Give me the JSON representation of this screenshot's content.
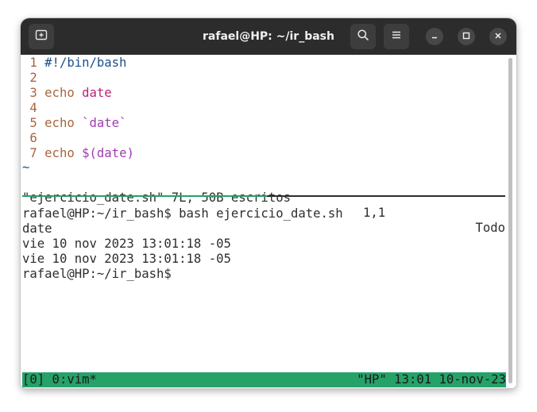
{
  "window": {
    "title": "rafael@HP: ~/ir_bash",
    "icons": {
      "new_tab": "new-tab-icon",
      "search": "search-icon",
      "menu": "hamburger-menu-icon",
      "minimize": "minimize-icon",
      "maximize": "maximize-icon",
      "close": "close-icon"
    }
  },
  "vim": {
    "lines": [
      {
        "num": "1",
        "parts": [
          {
            "text": "#!/bin/bash",
            "style": "shebang"
          }
        ]
      },
      {
        "num": "2",
        "parts": []
      },
      {
        "num": "3",
        "parts": [
          {
            "text": "echo ",
            "style": "kw"
          },
          {
            "text": "date",
            "style": "sym"
          }
        ]
      },
      {
        "num": "4",
        "parts": []
      },
      {
        "num": "5",
        "parts": [
          {
            "text": "echo ",
            "style": "kw"
          },
          {
            "text": "`date`",
            "style": "str"
          }
        ]
      },
      {
        "num": "6",
        "parts": []
      },
      {
        "num": "7",
        "parts": [
          {
            "text": "echo ",
            "style": "kw"
          },
          {
            "text": "$(date)",
            "style": "str"
          }
        ]
      }
    ],
    "tilde": "~",
    "status_message": "\"ejercicio_date.sh\" 7L, 50B escritos",
    "cursor_pos": "1,1",
    "scroll_pos": "Todo"
  },
  "shell": {
    "lines": [
      "rafael@HP:~/ir_bash$ bash ejercicio_date.sh",
      "date",
      "vie 10 nov 2023 13:01:18 -05",
      "vie 10 nov 2023 13:01:18 -05",
      "rafael@HP:~/ir_bash$ "
    ]
  },
  "tmux": {
    "left": "[0] 0:vim*",
    "right": "\"HP\" 13:01 10-nov-23"
  },
  "colors": {
    "titlebar": "#2c2c2c",
    "accent_green": "#26a269",
    "line_number": "#a8653b",
    "shebang": "#1b4f8a",
    "string": "#a03ab3"
  }
}
